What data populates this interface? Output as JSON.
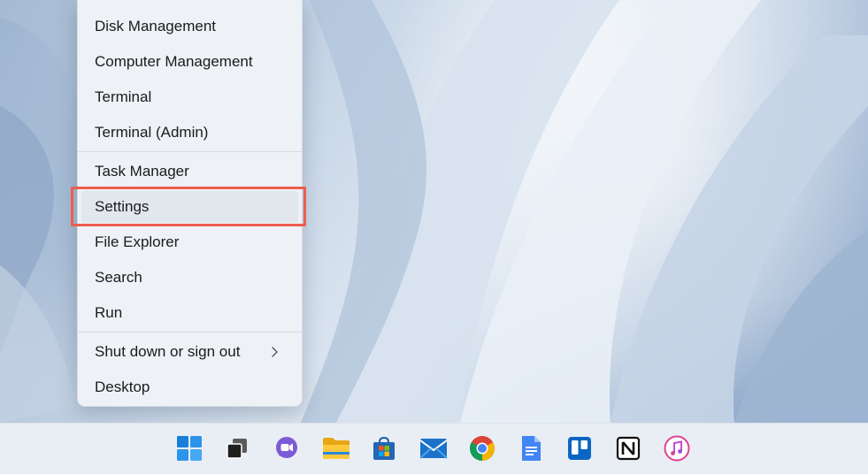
{
  "context_menu": {
    "groups": [
      [
        "Disk Management",
        "Computer Management",
        "Terminal",
        "Terminal (Admin)"
      ],
      [
        "Task Manager",
        "Settings",
        "File Explorer",
        "Search",
        "Run"
      ],
      [
        "Shut down or sign out",
        "Desktop"
      ]
    ],
    "items": {
      "disk_management": "Disk Management",
      "computer_management": "Computer Management",
      "terminal": "Terminal",
      "terminal_admin": "Terminal (Admin)",
      "task_manager": "Task Manager",
      "settings": "Settings",
      "file_explorer": "File Explorer",
      "search": "Search",
      "run": "Run",
      "shut_down": "Shut down or sign out",
      "desktop": "Desktop"
    },
    "highlighted_item": "Settings",
    "highlight_color": "#ec5f4f"
  },
  "taskbar": {
    "icons": [
      "windows-start-icon",
      "task-view-icon",
      "teams-chat-icon",
      "file-explorer-icon",
      "microsoft-store-icon",
      "mail-icon",
      "chrome-icon",
      "google-docs-icon",
      "trello-icon",
      "notion-icon",
      "itunes-icon"
    ]
  },
  "colors": {
    "menu_background": "#eef1f6",
    "taskbar_background": "#e9eef5",
    "windows_blue": "#1a7fd9",
    "text": "#1b1b1b"
  }
}
